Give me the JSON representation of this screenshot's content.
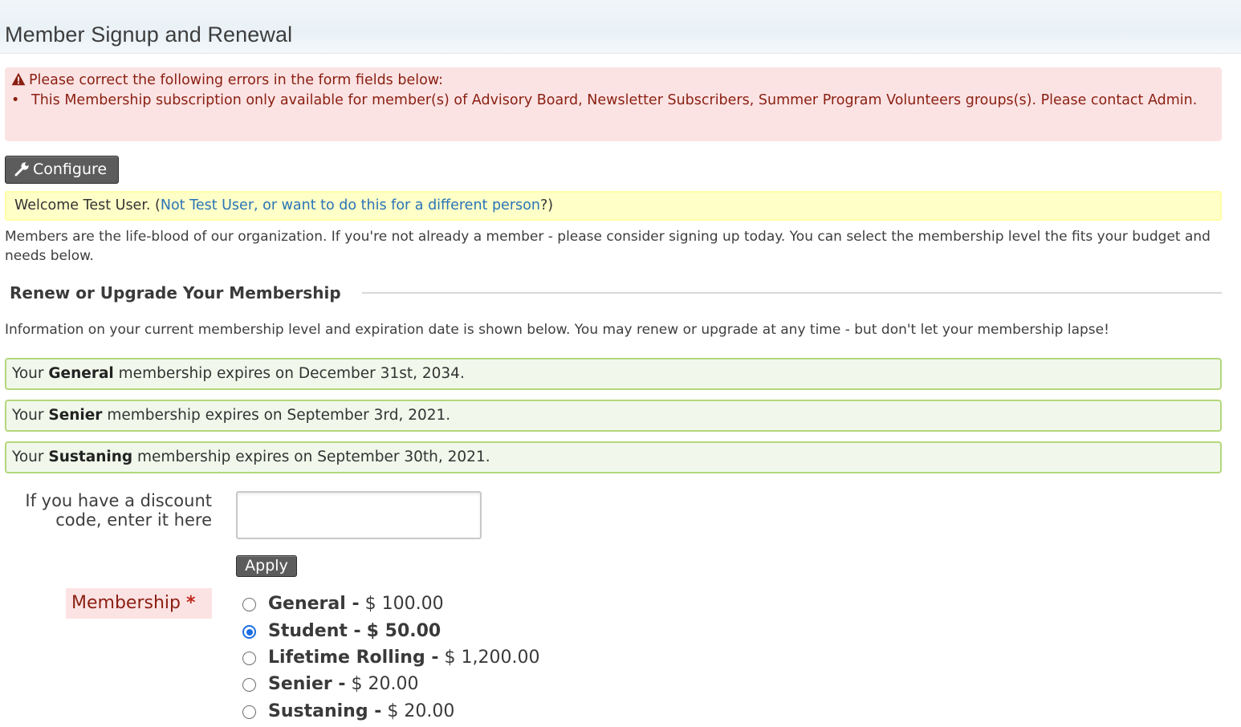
{
  "page": {
    "title": "Member Signup and Renewal"
  },
  "errors": {
    "heading": "Please correct the following errors in the form fields below:",
    "items": [
      "This Membership subscription only available for member(s) of Advisory Board, Newsletter Subscribers, Summer Program Volunteers groups(s). Please contact Admin."
    ]
  },
  "toolbar": {
    "configure_label": "Configure"
  },
  "welcome": {
    "prefix": "Welcome Test User. (",
    "link": "Not Test User, or want to do this for a different person",
    "suffix": "?)"
  },
  "intro": "Members are the life-blood of our organization. If you're not already a member - please consider signing up today. You can select the membership level the fits your budget and needs below.",
  "renewal": {
    "legend": "Renew or Upgrade Your Membership",
    "info": "Information on your current membership level and expiration date is shown below. You may renew or upgrade at any time - but don't let your membership lapse!",
    "statuses": [
      {
        "prefix": "Your ",
        "level": "General",
        "suffix": " membership expires on December 31st, 2034."
      },
      {
        "prefix": "Your ",
        "level": "Senier",
        "suffix": " membership expires on September 3rd, 2021."
      },
      {
        "prefix": "Your ",
        "level": "Sustaning",
        "suffix": " membership expires on September 30th, 2021."
      }
    ]
  },
  "discount": {
    "label": "If you have a discount code, enter it here",
    "value": "",
    "apply_label": "Apply"
  },
  "membership": {
    "label": "Membership",
    "required_mark": "*",
    "options": [
      {
        "name": "General -",
        "price": "$ 100.00",
        "selected": false
      },
      {
        "name": "Student -",
        "price": "$ 50.00",
        "selected": true
      },
      {
        "name": "Lifetime Rolling -",
        "price": "$ 1,200.00",
        "selected": false
      },
      {
        "name": "Senier -",
        "price": "$ 20.00",
        "selected": false
      },
      {
        "name": "Sustaning -",
        "price": "$ 20.00",
        "selected": false
      }
    ]
  },
  "colors": {
    "error_bg": "#fbe3e4",
    "error_text": "#8a1f11",
    "notice_bg": "#ffffc8",
    "success_bg": "#f1f8eb",
    "success_border": "#b4d77c",
    "link": "#2a74b8",
    "button_bg": "#5c5c5c",
    "radio_accent": "#1a6fe3"
  }
}
